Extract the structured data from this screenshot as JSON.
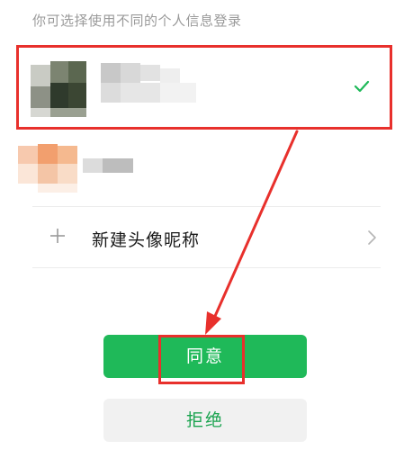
{
  "header": {
    "hint": "你可选择使用不同的个人信息登录"
  },
  "accounts": [
    {
      "selected": true,
      "name_visible": false,
      "avatar": "pixelated-avatar"
    },
    {
      "selected": false,
      "name_visible": false,
      "avatar": "pixelated-avatar"
    }
  ],
  "new_profile": {
    "label": "新建头像昵称",
    "icon": "plus-icon",
    "trailing_icon": "chevron-right-icon"
  },
  "actions": {
    "agree_label": "同意",
    "reject_label": "拒绝"
  },
  "colors": {
    "accent_green": "#1fb959",
    "reject_text_green": "#1aa34f",
    "annotation_red": "#e8302c",
    "hint_gray": "#9a9a9a"
  }
}
